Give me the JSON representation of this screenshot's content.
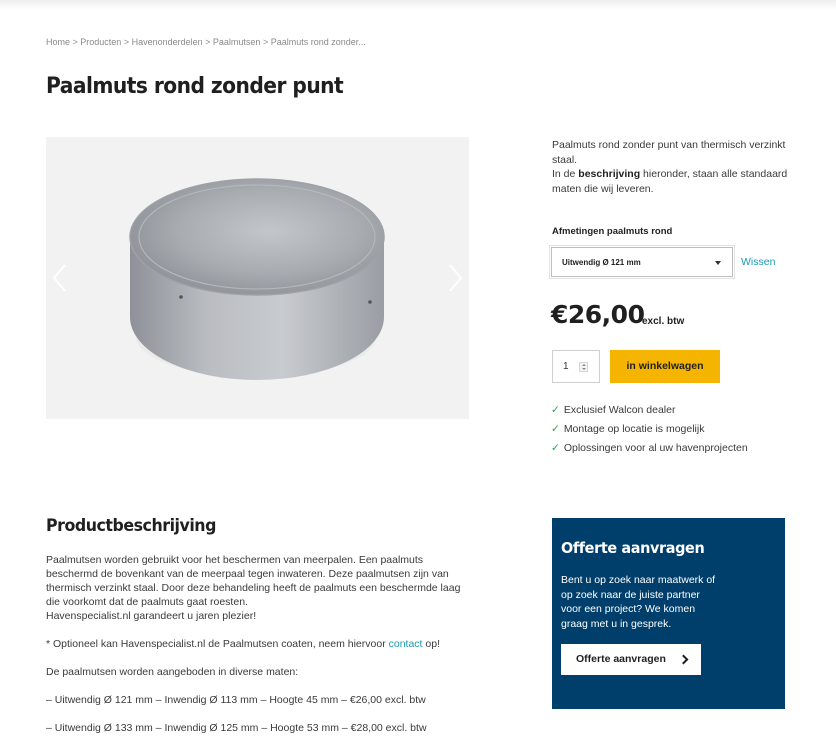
{
  "breadcrumb": {
    "items": [
      "Home",
      "Producten",
      "Havenonderdelen",
      "Paalmutsen",
      "Paalmuts rond zonder..."
    ],
    "separator": " > "
  },
  "product": {
    "title": "Paalmuts rond zonder punt",
    "intro_line1": "Paalmuts rond zonder punt van thermisch verzinkt staal.",
    "intro_pre": "In de ",
    "intro_bold": "beschrijving",
    "intro_post": " hieronder, staan alle standaard maten die wij leveren.",
    "option_label": "Afmetingen paalmuts rond",
    "option_selected": "Uitwendig Ø 121 mm",
    "clear_label": "Wissen",
    "price": "€26,00",
    "price_note": "excl. btw",
    "quantity": "1",
    "add_to_cart": "in winkelwagen",
    "usps": [
      "Exclusief Walcon dealer",
      "Montage op locatie is mogelijk",
      "Oplossingen voor al uw havenprojecten"
    ],
    "check_glyph": "✓"
  },
  "gallery": {
    "prev_icon": "chevron-left-icon",
    "next_icon": "chevron-right-icon",
    "background": "#f2f2f2"
  },
  "description": {
    "title": "Productbeschrijving",
    "paragraph1": "Paalmutsen worden gebruikt voor het beschermen van meerpalen. Een paalmuts beschermd de bovenkant van de meerpaal tegen inwateren. Deze paalmutsen zijn van thermisch verzinkt staal. Door deze behandeling heeft de paalmuts een beschermde laag die voorkomt dat de paalmuts gaat roesten.",
    "paragraph1b": "Havenspecialist.nl garandeert u jaren plezier!",
    "optional_pre": "* Optioneel kan Havenspecialist.nl de Paalmutsen coaten, neem hiervoor ",
    "optional_link": "contact",
    "optional_post": " op!",
    "sizes_intro": "De paalmutsen worden aangeboden in diverse maten:",
    "sizes": [
      "– Uitwendig Ø 121 mm – Inwendig Ø 113 mm – Hoogte 45 mm – €26,00 excl. btw",
      "– Uitwendig Ø 133 mm – Inwendig Ø 125 mm – Hoogte 53 mm – €28,00 excl. btw"
    ]
  },
  "offer": {
    "title": "Offerte aanvragen",
    "text": "Bent u op zoek naar maatwerk of op zoek naar de juiste partner voor een project? We komen graag met u in gesprek.",
    "button": "Offerte aanvragen"
  },
  "colors": {
    "accent_yellow": "#f4b400",
    "offer_blue": "#003f6b",
    "link_teal": "#1a9bb0",
    "check_green": "#2e9e4f"
  }
}
